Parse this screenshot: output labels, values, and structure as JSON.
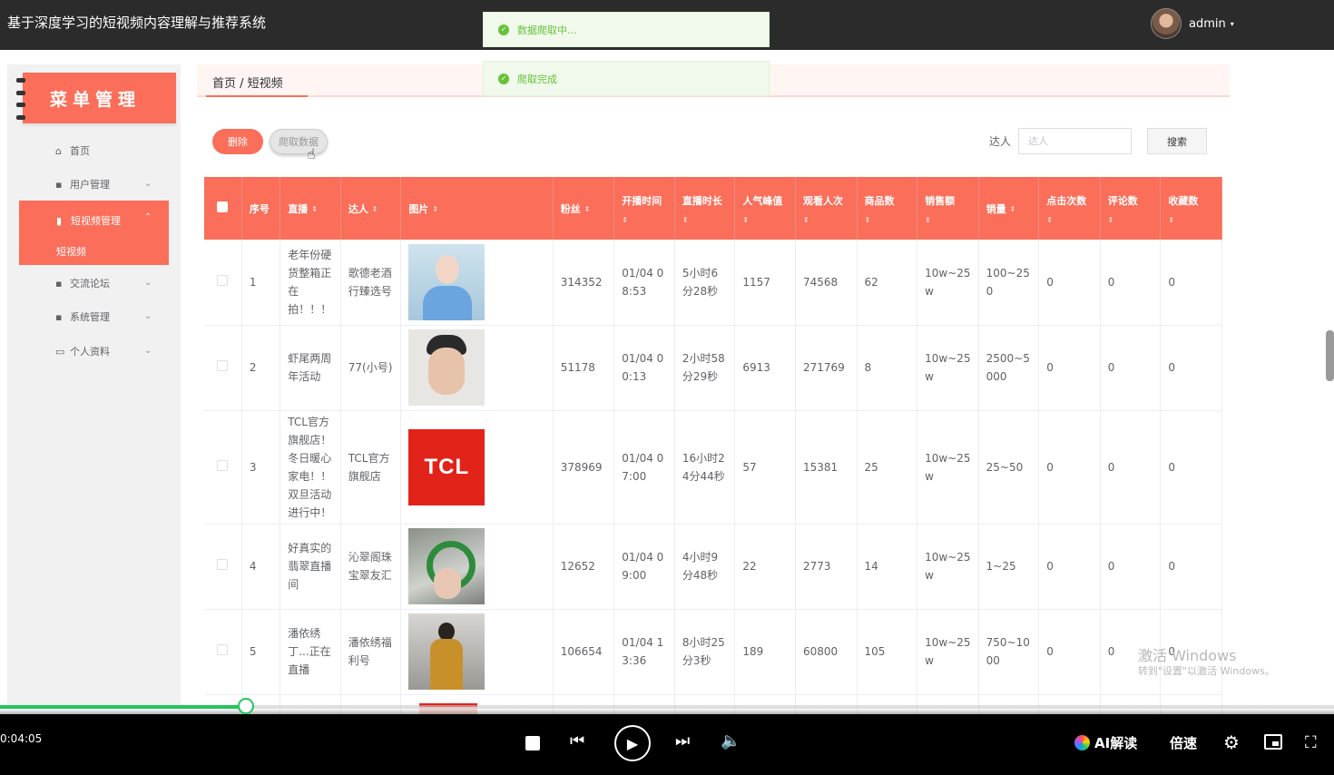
{
  "app": {
    "title": "基于深度学习的短视频内容理解与推荐系统",
    "username": "admin",
    "caret": "▾"
  },
  "toasts": [
    {
      "text": "数据爬取中...",
      "icon": "check-circle-icon"
    },
    {
      "text": "爬取完成",
      "icon": "check-circle-icon"
    }
  ],
  "sidebar": {
    "title": "菜单管理",
    "items": [
      {
        "label": "首页",
        "icon": "home-icon",
        "glyph": "⌂"
      },
      {
        "label": "用户管理",
        "icon": "grid-icon",
        "glyph": "▪"
      },
      {
        "label": "短视频管理",
        "icon": "lock-icon",
        "glyph": "▮"
      },
      {
        "label": "交流论坛",
        "icon": "grid-icon",
        "glyph": "▪"
      },
      {
        "label": "系统管理",
        "icon": "grid-icon",
        "glyph": "▪"
      },
      {
        "label": "个人资料",
        "icon": "card-icon",
        "glyph": "▭"
      }
    ],
    "active_sub": "短视频"
  },
  "breadcrumb": "首页 / 短视频",
  "toolbar": {
    "delete_label": "删除",
    "crawl_label": "爬取数据",
    "search_label": "达人",
    "search_placeholder": "达人",
    "search_value": "",
    "search_button": "搜索"
  },
  "table": {
    "headers": [
      "序号",
      "直播",
      "达人",
      "图片",
      "粉丝",
      "开播时间",
      "直播时长",
      "人气峰值",
      "观看人次",
      "商品数",
      "销售额",
      "销量",
      "点击次数",
      "评论数",
      "收藏数"
    ],
    "sort_glyph": "⇕",
    "rows": [
      {
        "no": "1",
        "live": "老年份硬货整箱正在拍！！！",
        "talent": "歌德老酒行臻选号",
        "fans": "314352",
        "start": "01/04 08:53",
        "duration": "5小时6分28秒",
        "peak": "1157",
        "views": "74568",
        "goods": "62",
        "sales": "10w~25w",
        "volume": "100~250",
        "clicks": "0",
        "comments": "0",
        "favorites": "0"
      },
      {
        "no": "2",
        "live": "虾尾两周年活动",
        "talent": "77(小号)",
        "fans": "51178",
        "start": "01/04 00:13",
        "duration": "2小时58分29秒",
        "peak": "6913",
        "views": "271769",
        "goods": "8",
        "sales": "10w~25w",
        "volume": "2500~5000",
        "clicks": "0",
        "comments": "0",
        "favorites": "0"
      },
      {
        "no": "3",
        "live": "TCL官方旗舰店！冬日暖心家电！！双旦活动进行中！",
        "talent": "TCL官方旗舰店",
        "fans": "378969",
        "start": "01/04 07:00",
        "duration": "16小时24分44秒",
        "peak": "57",
        "views": "15381",
        "goods": "25",
        "sales": "10w~25w",
        "volume": "25~50",
        "clicks": "0",
        "comments": "0",
        "favorites": "0",
        "image_text": "TCL"
      },
      {
        "no": "4",
        "live": "好真实的翡翠直播间",
        "talent": "沁翠阁珠宝翠友汇",
        "fans": "12652",
        "start": "01/04 09:00",
        "duration": "4小时9分48秒",
        "peak": "22",
        "views": "2773",
        "goods": "14",
        "sales": "10w~25w",
        "volume": "1~25",
        "clicks": "0",
        "comments": "0",
        "favorites": "0"
      },
      {
        "no": "5",
        "live": "潘依绣丁...正在直播",
        "talent": "潘依绣福利号",
        "fans": "106654",
        "start": "01/04 13:36",
        "duration": "8小时25分3秒",
        "peak": "189",
        "views": "60800",
        "goods": "105",
        "sales": "10w~25w",
        "volume": "750~1000",
        "clicks": "0",
        "comments": "0",
        "favorites": "0"
      }
    ]
  },
  "watermark": {
    "line1": "激活 Windows",
    "line2": "转到\"设置\"以激活 Windows。"
  },
  "player": {
    "time": "0:04:05",
    "progress": 0.18,
    "ai_label": "AI解读",
    "speed_label": "倍速",
    "colors": {
      "accent": "#22c55e",
      "brand": "#fa6e5a"
    }
  }
}
